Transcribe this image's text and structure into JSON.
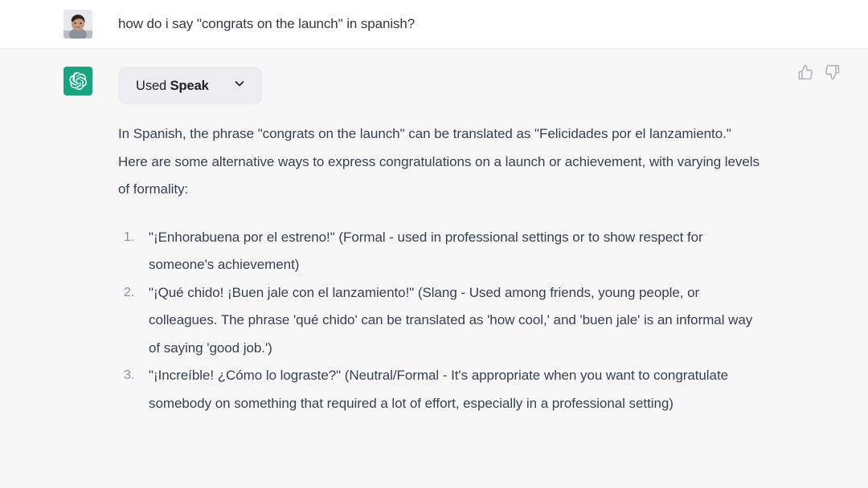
{
  "colors": {
    "user_row_bg": "#ffffff",
    "assistant_row_bg": "#f7f7f8",
    "brand_green": "#19a47f",
    "chip_bg": "#ececf1",
    "body_text": "#374151",
    "muted_text": "#8e8ea0",
    "icon_gray": "#b4b7c1",
    "divider": "#ececf1"
  },
  "user_message": {
    "avatar_icon": "user-photo-avatar",
    "text": "how do i say \"congrats on the launch\" in spanish?"
  },
  "assistant_message": {
    "avatar_icon": "openai-logo-icon",
    "plugin_chip": {
      "prefix_label": "Used",
      "plugin_name": "Speak",
      "expand_icon": "chevron-down-icon"
    },
    "intro_paragraph": "In Spanish, the phrase \"congrats on the launch\" can be translated as \"Felicidades por el lanzamiento.\" Here are some alternative ways to express congratulations on a launch or achievement, with varying levels of formality:",
    "list_items": [
      "\"¡Enhorabuena por el estreno!\" (Formal - used in professional settings or to show respect for someone's achievement)",
      "\"¡Qué chido! ¡Buen jale con el lanzamiento!\" (Slang - Used among friends, young people, or colleagues. The phrase 'qué chido' can be translated as 'how cool,' and 'buen jale' is an informal way of saying 'good job.')",
      "\"¡Increíble! ¿Cómo lo lograste?\" (Neutral/Formal - It's appropriate when you want to congratulate somebody on something that required a lot of effort, especially in a professional setting)"
    ],
    "feedback": {
      "thumbs_up_icon": "thumbs-up-icon",
      "thumbs_down_icon": "thumbs-down-icon"
    }
  }
}
